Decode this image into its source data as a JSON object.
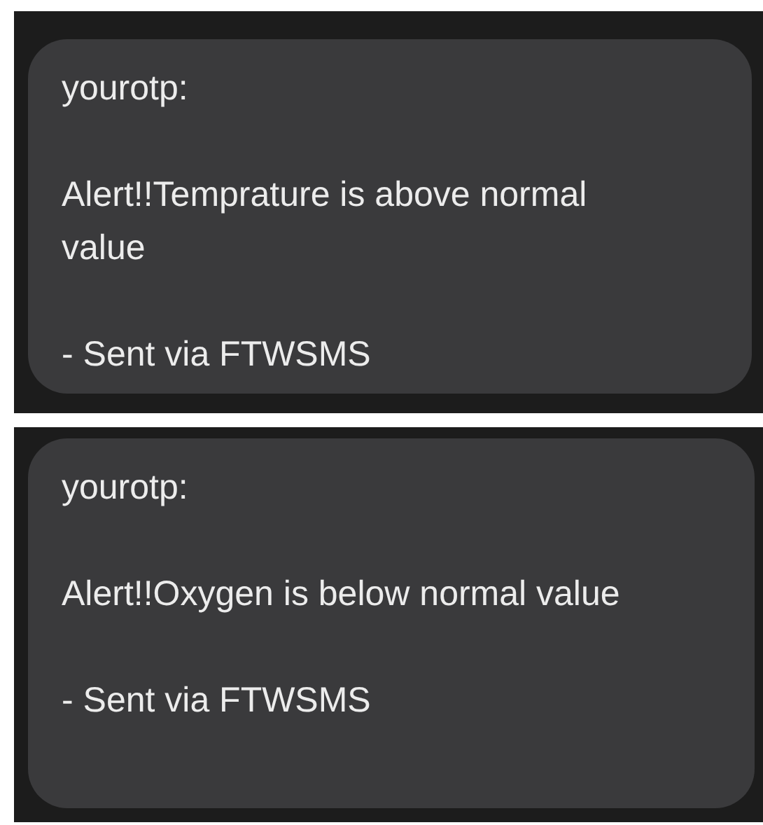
{
  "messages": [
    {
      "sender": "yourotp:",
      "body": "Alert!!Temprature is above normal value",
      "footer": "- Sent via FTWSMS"
    },
    {
      "sender": "yourotp:",
      "body": "Alert!!Oxygen is below normal value",
      "footer": "- Sent via FTWSMS"
    }
  ]
}
